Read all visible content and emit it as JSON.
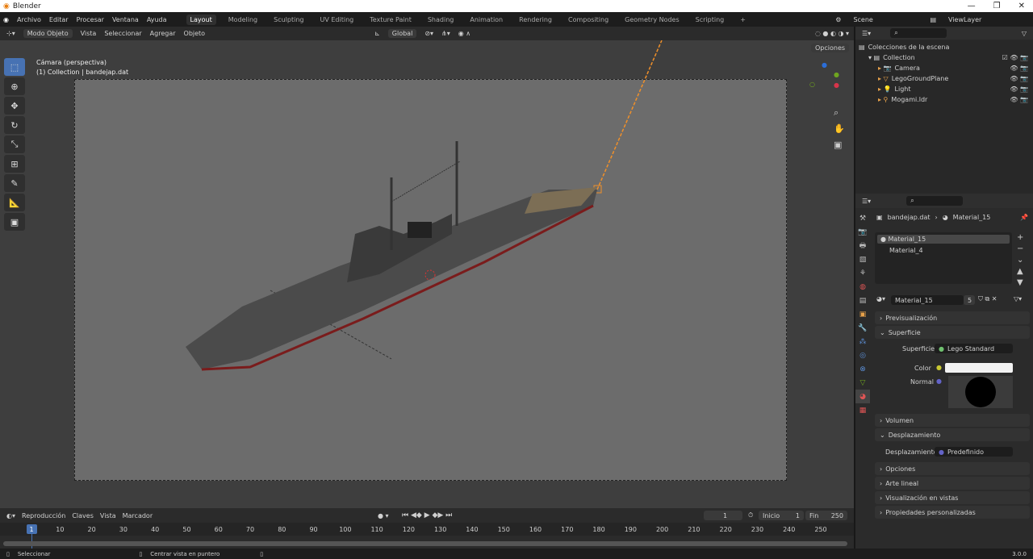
{
  "window": {
    "title": "Blender",
    "controls": [
      "—",
      "❐",
      "✕"
    ]
  },
  "menu": [
    "Archivo",
    "Editar",
    "Procesar",
    "Ventana",
    "Ayuda"
  ],
  "workspaces": [
    "Layout",
    "Modeling",
    "Sculpting",
    "UV Editing",
    "Texture Paint",
    "Shading",
    "Animation",
    "Rendering",
    "Compositing",
    "Geometry Nodes",
    "Scripting",
    "+"
  ],
  "scene": "Scene",
  "view_layer": "ViewLayer",
  "viewport": {
    "mode": "Modo Objeto",
    "menus": [
      "Vista",
      "Seleccionar",
      "Agregar",
      "Objeto"
    ],
    "transform": "Global",
    "options": "Opciones",
    "info_line1": "Cámara (perspectiva)",
    "info_line2": "(1) Collection | bandejap.dat"
  },
  "outliner": {
    "root": "Colecciones de la escena",
    "collection": "Collection",
    "items": [
      "Camera",
      "LegoGroundPlane",
      "Light",
      "Mogami.ldr"
    ]
  },
  "properties": {
    "breadcrumb_object": "bandejap.dat",
    "breadcrumb_material": "Material_15",
    "slots": [
      "Material_15",
      "Material_4"
    ],
    "material_name": "Material_15",
    "users": "5",
    "panels": {
      "preview": "Previsualización",
      "surface": "Superficie",
      "volume": "Volumen",
      "displacement": "Desplazamiento",
      "options": "Opciones",
      "line_art": "Arte lineal",
      "viewport_display": "Visualización en vistas",
      "custom_props": "Propiedades personalizadas"
    },
    "surface_label": "Superficie",
    "surface_value": "Lego Standard",
    "color_label": "Color",
    "normal_label": "Normal",
    "disp_label": "Desplazamiento",
    "disp_value": "Predefinido"
  },
  "timeline": {
    "menus": [
      "Reproducción",
      "Claves",
      "Vista",
      "Marcador"
    ],
    "current_frame": "1",
    "start_label": "Inicio",
    "start": "1",
    "end_label": "Fin",
    "end": "250",
    "ticks": [
      "1",
      "10",
      "20",
      "30",
      "40",
      "50",
      "60",
      "70",
      "80",
      "90",
      "100",
      "110",
      "120",
      "130",
      "140",
      "150",
      "160",
      "170",
      "180",
      "190",
      "200",
      "210",
      "220",
      "230",
      "240",
      "250"
    ]
  },
  "status": {
    "select": "Seleccionar",
    "center": "Centrar vista en puntero",
    "version": "3.0.0"
  }
}
